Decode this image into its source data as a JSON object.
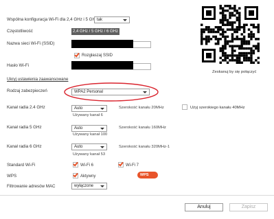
{
  "shared_config": {
    "label": "Wspólna konfiguracja Wi-Fi dla 2,4 GHz i 5 GHz",
    "value": "tak"
  },
  "frequency": {
    "label": "Częstotliwość",
    "value": "2,4 GHz / 5 GHz / 6 GHz"
  },
  "ssid": {
    "label": "Nazwa sieci Wi-Fi (SSID)",
    "broadcast_label": "Rozgłaszaj SSID"
  },
  "password": {
    "label": "Hasło Wi-Fi"
  },
  "qr": {
    "caption": "Zeskanuj by się połączyć"
  },
  "advanced": {
    "toggle_label": "Ukryj ustawienia zaawansowane",
    "security": {
      "label": "Rodzaj zabezpieczeń",
      "value": "WPA2 Personal"
    },
    "ch24": {
      "label": "Kanał radia 2.4 GHz",
      "value": "Auto",
      "used": "Używany kanał  6",
      "width_label": "Szerokość kanału 20MHz",
      "wide_label": "Użyj szerokiego kanału 40MHz"
    },
    "ch5": {
      "label": "Kanał radia 5 GHz",
      "value": "Auto",
      "used": "Używany kanał  100",
      "width_label": "Szerokość kanału 160MHz"
    },
    "ch6": {
      "label": "Kanał radia 6 GHz",
      "value": "Auto",
      "used": "Używany kanał  53",
      "width_label": "Szerokość kanału 320MHz-1"
    },
    "standard": {
      "label": "Standard Wi-Fi",
      "wifi6": "Wi-Fi 6",
      "wifi7": "Wi-Fi 7"
    },
    "wps": {
      "label": "WPS",
      "active": "Aktywny",
      "badge": "WPS"
    },
    "mac": {
      "label": "Filtrowanie adresów MAC",
      "value": "wyłączone"
    }
  },
  "buttons": {
    "cancel": "Anuluj",
    "save": "Zapisz"
  },
  "colors": {
    "accent": "#e8542a",
    "highlight": "#d9232d"
  }
}
